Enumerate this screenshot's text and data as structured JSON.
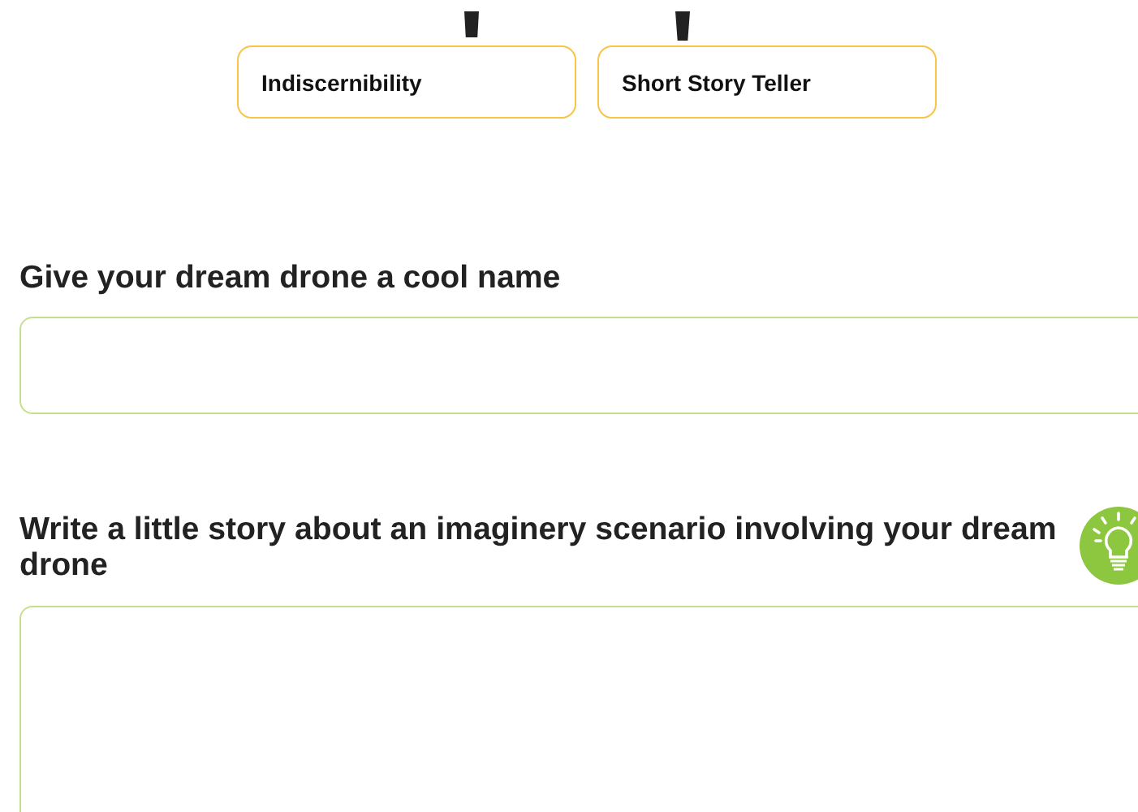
{
  "options": [
    {
      "label": "Indiscernibility"
    },
    {
      "label": "Short Story Teller"
    }
  ],
  "questions": [
    {
      "label": "Give your dream drone a cool name",
      "kind": "line",
      "hint": false
    },
    {
      "label": "Write a little story about an imaginery scenario involving your dream drone",
      "kind": "area",
      "hint": true
    }
  ]
}
